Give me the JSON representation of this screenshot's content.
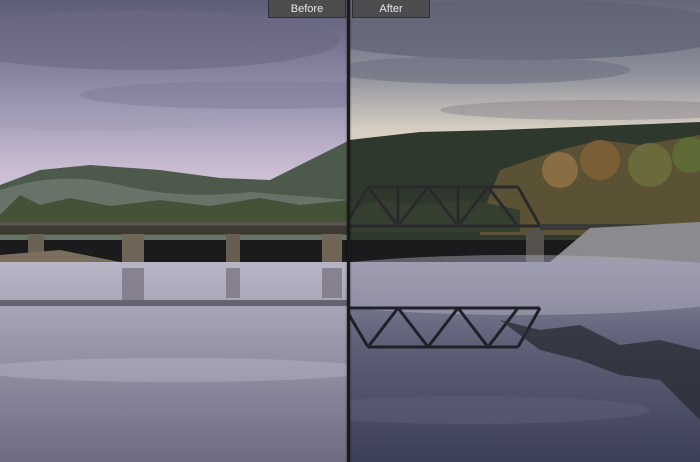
{
  "labels": {
    "before": "Before",
    "after": "After"
  },
  "colors": {
    "before_sky_top": "#5f5f78",
    "before_sky_bottom": "#d4c6d8",
    "after_sky_top": "#6a6f80",
    "after_sky_bottom": "#e7dfd2",
    "divider": "#1a1a1a",
    "tag_bg": "#4d4d50"
  }
}
